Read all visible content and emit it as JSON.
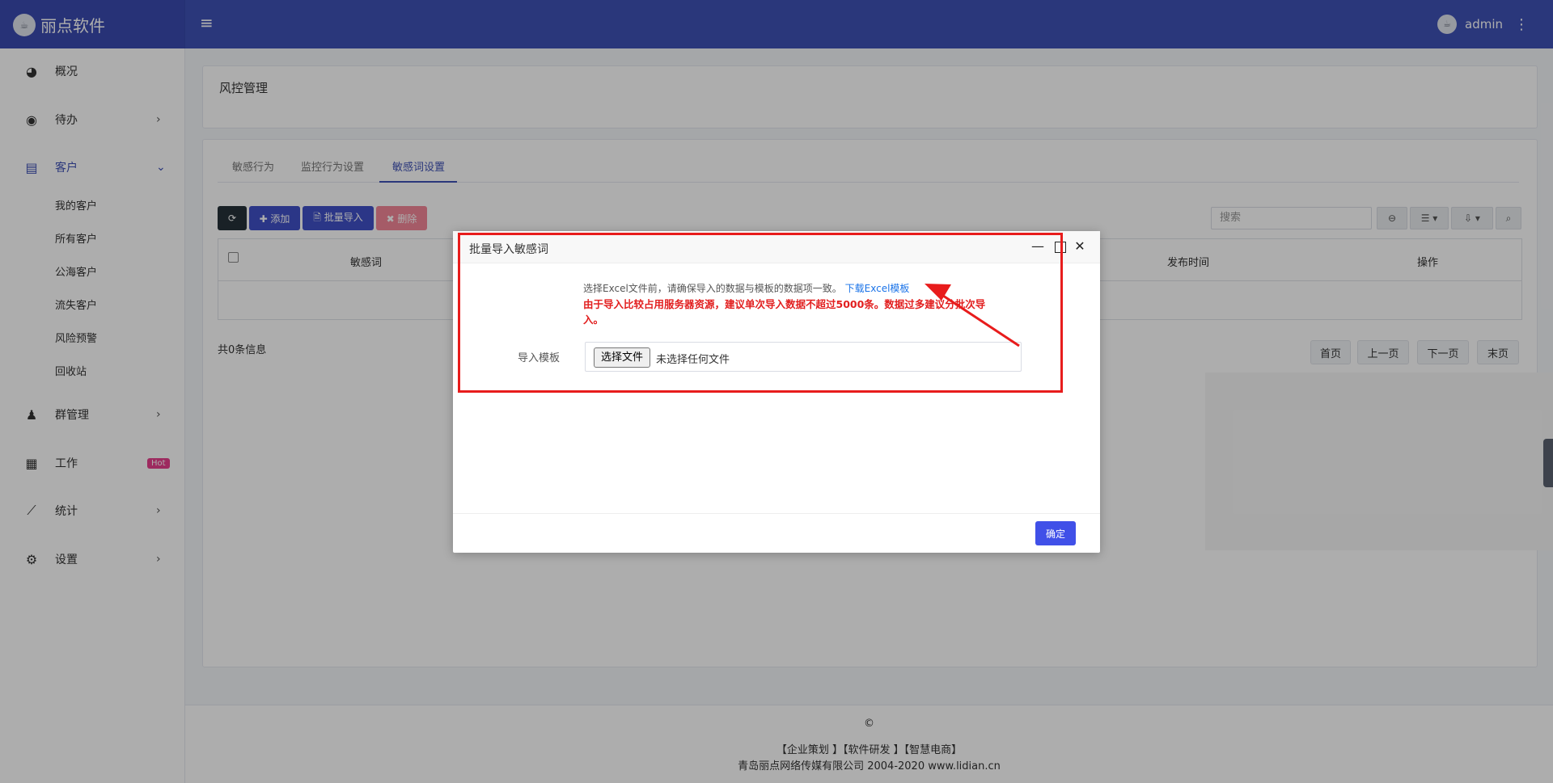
{
  "brand": {
    "name": "丽点软件",
    "logo_text": "☕"
  },
  "topbar": {
    "menu_icon": "≡",
    "user_name": "admin",
    "more_icon": "⋮"
  },
  "sidebar": {
    "items": [
      {
        "label": "概况",
        "icon": "◕"
      },
      {
        "label": "待办",
        "icon": "◉",
        "arrow": "›"
      },
      {
        "label": "客户",
        "icon": "▤",
        "arrow": "⌄"
      },
      {
        "label": "群管理",
        "icon": "♟",
        "arrow": "›"
      },
      {
        "label": "工作",
        "icon": "▦",
        "badge": "Hot"
      },
      {
        "label": "统计",
        "icon": "⟋",
        "arrow": "›"
      },
      {
        "label": "设置",
        "icon": "⚙",
        "arrow": "›"
      }
    ],
    "subitems": [
      "我的客户",
      "所有客户",
      "公海客户",
      "流失客户",
      "风险预警",
      "回收站"
    ]
  },
  "page": {
    "title": "风控管理"
  },
  "tabs": [
    "敏感行为",
    "监控行为设置",
    "敏感词设置"
  ],
  "toolbar": {
    "refresh_icon": "⟳",
    "add": "✚ 添加",
    "import": "🗎 批量导入",
    "delete": "✖ 删除",
    "search_placeholder": "搜索",
    "columns_icon": "⊖",
    "list_icon": "☰ ▾",
    "export_icon": "⇩ ▾",
    "search_icon": "⌕"
  },
  "table": {
    "headers": [
      "敏感词",
      "发布时间",
      "操作"
    ]
  },
  "info": "共0条信息",
  "pager": [
    "首页",
    "上一页",
    "下一页",
    "末页"
  ],
  "footer": {
    "copyright": "©",
    "links": "【企业策划 】【软件研发 】【智慧电商】",
    "company": "青岛丽点网络传媒有限公司 2004-2020 www.lidian.cn"
  },
  "modal": {
    "title": "批量导入敏感词",
    "minimize": "—",
    "close": "✕",
    "hint": "选择Excel文件前，请确保导入的数据与模板的数据项一致。",
    "hint_link": "下载Excel模板",
    "warning": "由于导入比较占用服务器资源，建议单次导入数据不超过5000条。数据过多建议分批次导入。",
    "label": "导入模板",
    "file_button": "选择文件",
    "file_status": "未选择任何文件",
    "confirm": "确定"
  },
  "colors": {
    "primary": "#3f51b5",
    "accent": "#4050e8",
    "warning": "#e21f1f",
    "link": "#1a73e8"
  }
}
